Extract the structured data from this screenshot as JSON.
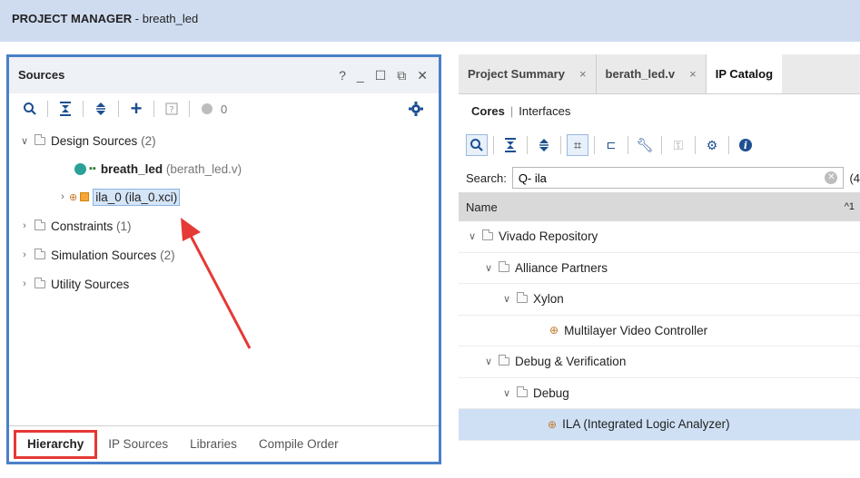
{
  "title_bar": {
    "label_bold": "PROJECT MANAGER",
    "label_rest": " - breath_led"
  },
  "sources": {
    "title": "Sources",
    "window_controls": [
      "?",
      "_",
      "☐",
      "⧉",
      "✕"
    ],
    "toolbar": {
      "badge_count": "0"
    },
    "tree": {
      "design_sources": {
        "label": "Design Sources",
        "count": "(2)"
      },
      "breath_led": {
        "name": "breath_led",
        "file": "(berath_led.v)"
      },
      "ila": {
        "label": "ila_0 (ila_0.xci)"
      },
      "constraints": {
        "label": "Constraints",
        "count": "(1)"
      },
      "simulation": {
        "label": "Simulation Sources",
        "count": "(2)"
      },
      "utility": {
        "label": "Utility Sources"
      }
    },
    "bottom_tabs": [
      "Hierarchy",
      "IP Sources",
      "Libraries",
      "Compile Order"
    ]
  },
  "right_panel": {
    "tabs": [
      {
        "label": "Project Summary",
        "close": "×"
      },
      {
        "label": "berath_led.v",
        "close": "×"
      },
      {
        "label": "IP Catalog"
      }
    ],
    "subnav": {
      "cores": "Cores",
      "sep": "|",
      "interfaces": "Interfaces"
    },
    "search": {
      "label": "Search:",
      "value": "Q- ila",
      "result_count": "(4"
    },
    "grid_header": {
      "name": "Name",
      "sort": "^1"
    },
    "rows": [
      "Vivado Repository",
      "Alliance Partners",
      "Xylon",
      "Multilayer Video Controller",
      "Debug & Verification",
      "Debug",
      "ILA (Integrated Logic Analyzer)"
    ]
  },
  "colors": {
    "accent_border": "#4a80c8",
    "highlight_red": "#e53935",
    "selection": "#cfe0f5"
  }
}
